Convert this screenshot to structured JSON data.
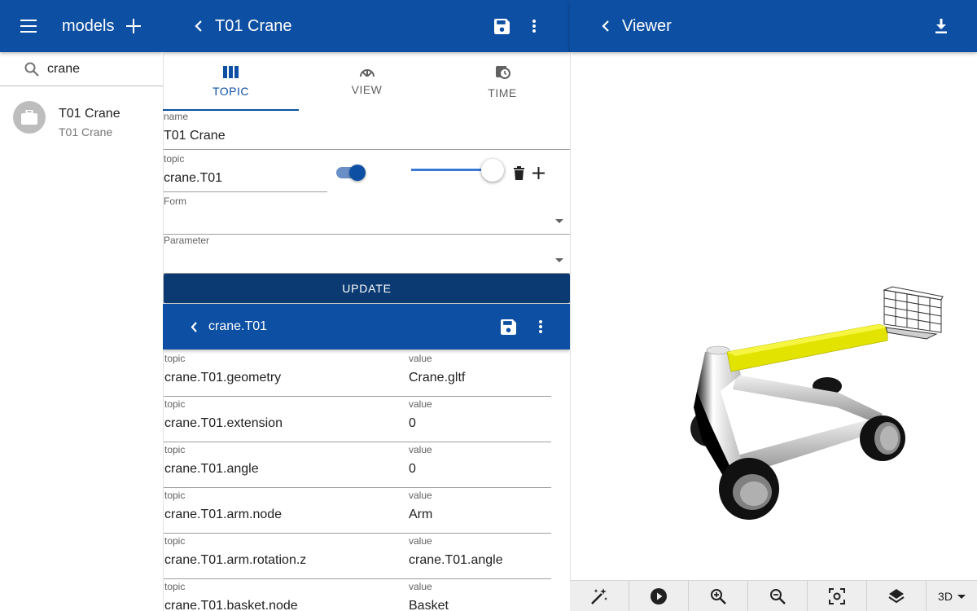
{
  "models_panel": {
    "title": "models",
    "search": {
      "value": "crane"
    },
    "items": [
      {
        "primary": "T01 Crane",
        "secondary": "T01 Crane"
      }
    ]
  },
  "editor": {
    "title": "T01 Crane",
    "tabs": [
      {
        "label": "TOPIC"
      },
      {
        "label": "VIEW"
      },
      {
        "label": "TIME"
      }
    ],
    "name": {
      "label": "name",
      "value": "T01 Crane"
    },
    "topic": {
      "label": "topic",
      "value": "crane.T01",
      "toggle_on": true,
      "slider_level": 1.0
    },
    "form": {
      "label": "Form",
      "value": ""
    },
    "parameter": {
      "label": "Parameter",
      "value": ""
    },
    "update_label": "UPDATE"
  },
  "topic_panel": {
    "title": "crane.T01",
    "col_topic": "topic",
    "col_value": "value",
    "rows": [
      {
        "topic": "crane.T01.geometry",
        "value": "Crane.gltf"
      },
      {
        "topic": "crane.T01.extension",
        "value": "0"
      },
      {
        "topic": "crane.T01.angle",
        "value": "0"
      },
      {
        "topic": "crane.T01.arm.node",
        "value": "Arm"
      },
      {
        "topic": "crane.T01.arm.rotation.z",
        "value": "crane.T01.angle"
      },
      {
        "topic": "crane.T01.basket.node",
        "value": "Basket"
      }
    ]
  },
  "viewer": {
    "title": "Viewer",
    "mode": "3D",
    "toolbar_icons": [
      "magic-wand-icon",
      "play-icon",
      "zoom-in-icon",
      "zoom-out-icon",
      "center-focus-icon",
      "layers-icon"
    ]
  },
  "colors": {
    "primary": "#0d4fa3",
    "primary_dark": "#0b3a73",
    "boom": "#e3e300"
  }
}
